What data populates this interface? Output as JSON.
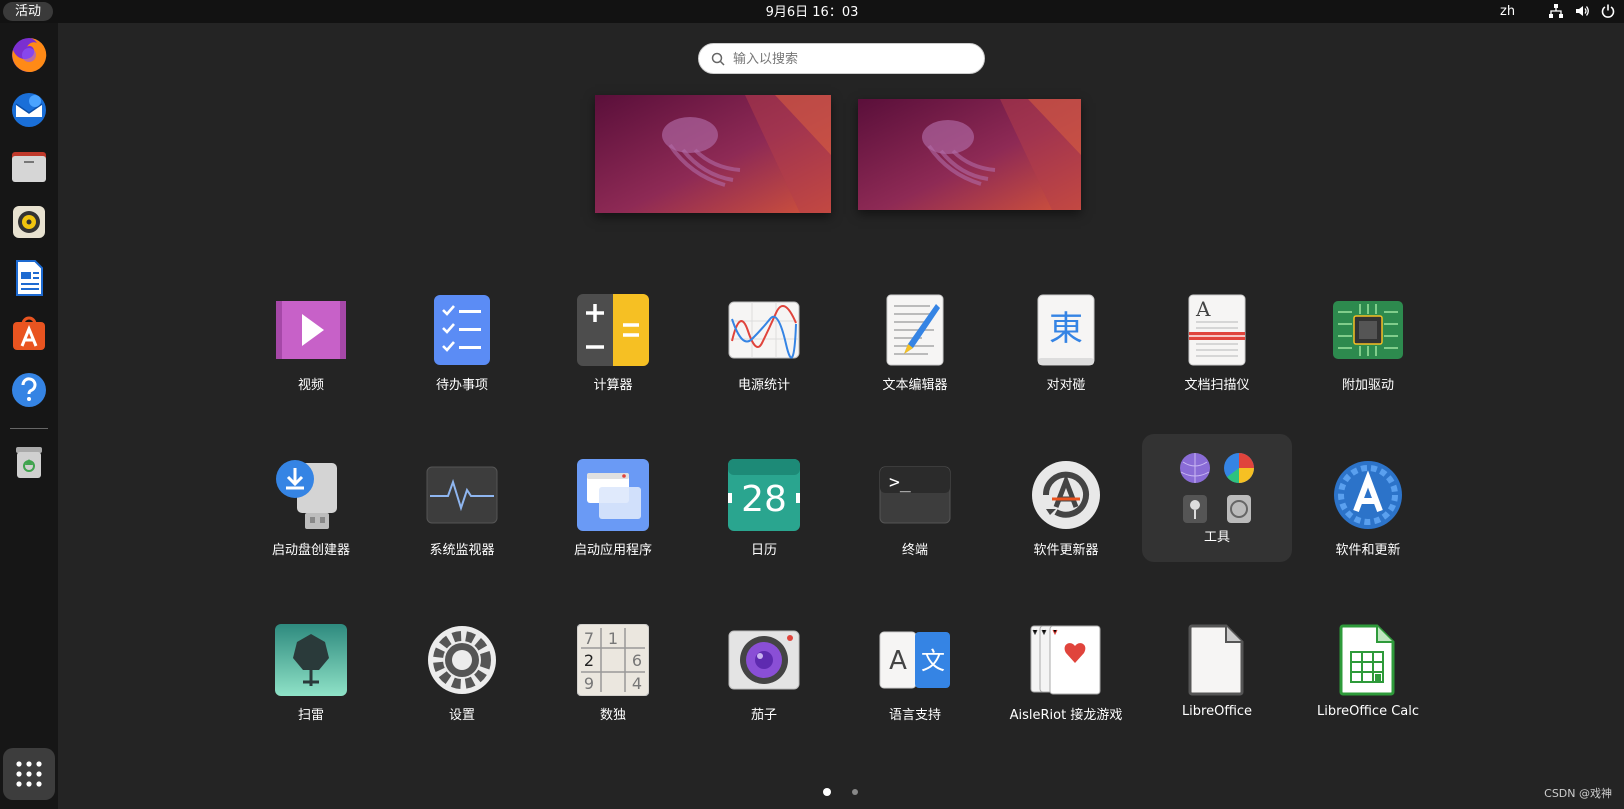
{
  "topbar": {
    "activities": "活动",
    "clock": "9月6日  16：03",
    "lang": "zh",
    "tray_icons": [
      "network-icon",
      "volume-icon",
      "power-icon"
    ]
  },
  "dock": {
    "items": [
      "firefox-icon",
      "thunderbird-icon",
      "files-icon",
      "rhythmbox-icon",
      "libreoffice-writer-icon",
      "app-center-icon",
      "help-icon",
      "trash-icon"
    ],
    "grid": "show-apps-icon"
  },
  "search": {
    "placeholder": "输入以搜索"
  },
  "apps": [
    {
      "label": "视频",
      "icon": "video-icon"
    },
    {
      "label": "待办事项",
      "icon": "todo-icon"
    },
    {
      "label": "计算器",
      "icon": "calculator-icon"
    },
    {
      "label": "电源统计",
      "icon": "power-statistics-icon"
    },
    {
      "label": "文本编辑器",
      "icon": "text-editor-icon"
    },
    {
      "label": "对对碰",
      "icon": "mahjongg-icon"
    },
    {
      "label": "文档扫描仪",
      "icon": "document-scanner-icon"
    },
    {
      "label": "附加驱动",
      "icon": "additional-drivers-icon"
    },
    {
      "label": "启动盘创建器",
      "icon": "usb-creator-icon"
    },
    {
      "label": "系统监视器",
      "icon": "system-monitor-icon"
    },
    {
      "label": "启动应用程序",
      "icon": "startup-apps-icon"
    },
    {
      "label": "日历",
      "icon": "calendar-icon",
      "number": "28"
    },
    {
      "label": "终端",
      "icon": "terminal-icon",
      "prompt": ">_"
    },
    {
      "label": "软件更新器",
      "icon": "software-updater-icon"
    },
    {
      "label": "工具",
      "icon": "utilities-folder-icon"
    },
    {
      "label": "软件和更新",
      "icon": "software-properties-icon"
    },
    {
      "label": "扫雷",
      "icon": "mines-icon"
    },
    {
      "label": "设置",
      "icon": "settings-icon"
    },
    {
      "label": "数独",
      "icon": "sudoku-icon"
    },
    {
      "label": "茄子",
      "icon": "cheese-icon"
    },
    {
      "label": "语言支持",
      "icon": "language-support-icon"
    },
    {
      "label": "AisleRiot 接龙游戏",
      "icon": "aisleriot-icon"
    },
    {
      "label": "LibreOffice",
      "icon": "libreoffice-icon"
    },
    {
      "label": "LibreOffice Calc",
      "icon": "libreoffice-calc-icon"
    }
  ],
  "calendar_day": "28",
  "terminal_prompt": ">_",
  "sudoku_digits": [
    "7",
    "1",
    "",
    "2",
    "",
    "6",
    "9",
    "",
    "4"
  ],
  "language_letters": [
    "A",
    "文"
  ],
  "mahjongg_char": "東",
  "scanner_char": "A",
  "pager": {
    "active": 0,
    "count": 2
  },
  "watermark": "CSDN @戏神",
  "colors": {
    "panel": "#121212",
    "dock": "#161616",
    "background": "#242424",
    "ubuntu_orange": "#e95420"
  }
}
